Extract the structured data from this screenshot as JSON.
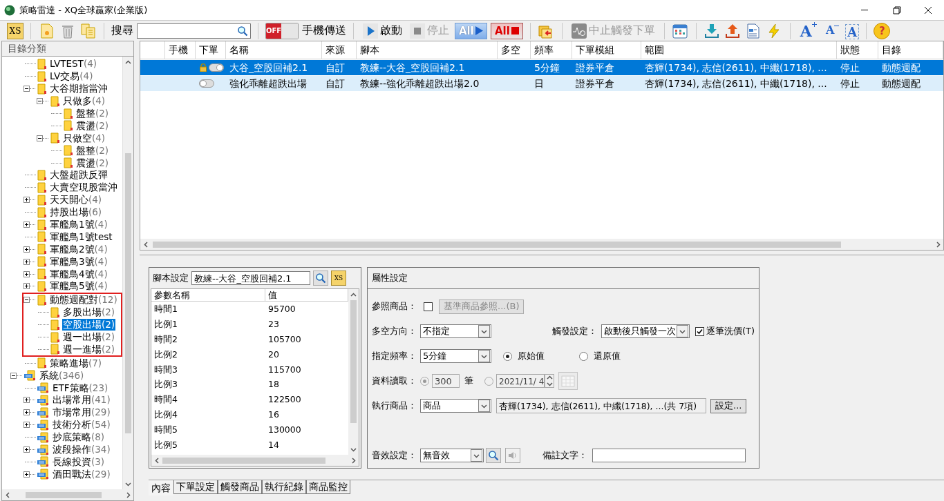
{
  "window": {
    "title": "策略雷達 - XQ全球贏家(企業版)"
  },
  "toolbar": {
    "xs_label": "XS",
    "search_label": "搜尋",
    "phone_switch": {
      "label": "OFF",
      "on": false
    },
    "phone_label": "手機傳送",
    "start": {
      "label": "啟動",
      "disabled": false
    },
    "stop": {
      "label": "停止",
      "disabled": true
    },
    "start_all": {
      "label": "All",
      "disabled": false
    },
    "stop_all": {
      "label": "All",
      "disabled": false
    },
    "abort": {
      "label": "中止觸發下單",
      "disabled": true
    },
    "font_buttons": [
      {
        "label": "A",
        "kind": "larger"
      },
      {
        "label": "A",
        "kind": "smaller"
      },
      {
        "label": "A",
        "kind": "reset"
      }
    ],
    "help_label": "?"
  },
  "tree": {
    "title": "目錄分類",
    "items": [
      {
        "label": "LVTEST",
        "count": "(4)",
        "selected": false
      },
      {
        "label": "LV交易",
        "count": "(4)",
        "selected": false
      },
      {
        "label": "大谷期指當沖",
        "expanded": true,
        "selected": false,
        "children": [
          {
            "label": "只做多",
            "count": "(4)",
            "expanded": true,
            "selected": false,
            "children": [
              {
                "label": "盤整",
                "count": "(2)",
                "selected": false
              },
              {
                "label": "震盪",
                "count": "(2)",
                "selected": false
              }
            ]
          },
          {
            "label": "只做空",
            "count": "(4)",
            "expanded": true,
            "selected": false,
            "children": [
              {
                "label": "盤整",
                "count": "(2)",
                "selected": false
              },
              {
                "label": "震盪",
                "count": "(2)",
                "selected": false
              }
            ]
          }
        ]
      },
      {
        "label": "大盤超跌反彈",
        "selected": false
      },
      {
        "label": "大賣空現股當沖",
        "selected": false
      },
      {
        "label": "天天開心",
        "count": "(4)",
        "expanded": false,
        "selected": false
      },
      {
        "label": "持股出場",
        "count": "(6)",
        "selected": false
      },
      {
        "label": "軍艦鳥1號",
        "count": "(4)",
        "expanded": false,
        "selected": false
      },
      {
        "label": "軍艦鳥1號test",
        "selected": false
      },
      {
        "label": "軍艦鳥2號",
        "count": "(4)",
        "expanded": false,
        "selected": false
      },
      {
        "label": "軍艦鳥3號",
        "count": "(4)",
        "expanded": false,
        "selected": false
      },
      {
        "label": "軍艦鳥4號",
        "count": "(4)",
        "expanded": false,
        "selected": false
      },
      {
        "label": "軍艦鳥5號",
        "count": "(4)",
        "expanded": false,
        "selected": false
      },
      {
        "label": "動態週配對",
        "count": "(12)",
        "expanded": true,
        "highlighted": true,
        "selected": false,
        "children": [
          {
            "label": "多股出場",
            "count": "(2)",
            "selected": false
          },
          {
            "label": "空股出場",
            "count": "(2)",
            "selected": true
          },
          {
            "label": "週一出場",
            "count": "(2)",
            "selected": false
          },
          {
            "label": "週一進場",
            "count": "(2)",
            "selected": false
          }
        ]
      },
      {
        "label": "策略進場",
        "count": "(7)",
        "selected": false
      }
    ],
    "system": {
      "label": "系統",
      "count": "(346)",
      "expanded": true,
      "selected": false,
      "children": [
        {
          "label": "ETF策略",
          "count": "(23)",
          "selected": false
        },
        {
          "label": "出場常用",
          "count": "(41)",
          "expanded": false,
          "selected": false
        },
        {
          "label": "市場常用",
          "count": "(29)",
          "expanded": false,
          "selected": false
        },
        {
          "label": "技術分析",
          "count": "(54)",
          "expanded": false,
          "selected": false
        },
        {
          "label": "抄底策略",
          "count": "(8)",
          "selected": false
        },
        {
          "label": "波段操作",
          "count": "(34)",
          "expanded": false,
          "selected": false
        },
        {
          "label": "長線投資",
          "count": "(3)",
          "selected": false
        },
        {
          "label": "酒田戰法",
          "count": "(29)",
          "expanded": false,
          "selected": false
        }
      ]
    }
  },
  "strategies": {
    "columns": [
      "手機",
      "下單",
      "名稱",
      "來源",
      "腳本",
      "多空",
      "頻率",
      "下單模組",
      "範圍",
      "狀態",
      "目錄"
    ],
    "rows": [
      {
        "selected": true,
        "locked": true,
        "name": "大谷_空股回補2.1",
        "source": "自訂",
        "script": "教練--大谷_空股回補2.1",
        "frequency": "5分鐘",
        "order_module": "證券平倉",
        "range": "杏輝(1734), 志信(2611), 中纖(1718), ...",
        "status": "停止",
        "directory": "動態週配"
      },
      {
        "selected": false,
        "locked": false,
        "name": "強化乖離超跌出場",
        "source": "自訂",
        "script": "教練--強化乖離超跌出場2.0",
        "frequency": "日",
        "order_module": "證券平倉",
        "range": "杏輝(1734), 志信(2611), 中纖(1718), ...",
        "status": "停止",
        "directory": "動態週配"
      }
    ]
  },
  "script_settings": {
    "label": "腳本設定",
    "script": "教練--大谷_空股回補2.1",
    "xs_label": "XS",
    "columns": [
      "參數名稱",
      "值"
    ],
    "params": [
      {
        "name": "時間1",
        "value": "95700"
      },
      {
        "name": "比例1",
        "value": "23"
      },
      {
        "name": "時間2",
        "value": "105700"
      },
      {
        "name": "比例2",
        "value": "20"
      },
      {
        "name": "時間3",
        "value": "115700"
      },
      {
        "name": "比例3",
        "value": "18"
      },
      {
        "name": "時間4",
        "value": "122500"
      },
      {
        "name": "比例4",
        "value": "16"
      },
      {
        "name": "時間5",
        "value": "130000"
      },
      {
        "name": "比例5",
        "value": "14"
      }
    ]
  },
  "properties": {
    "title": "屬性設定",
    "reference": {
      "label": "參照商品：",
      "checked": false,
      "button": "基準商品參照...(B)",
      "button_disabled": true
    },
    "direction": {
      "label": "多空方向：",
      "value": "不指定"
    },
    "trigger": {
      "label": "觸發設定：",
      "value": "啟動後只觸發一次"
    },
    "tick_wash": {
      "label": "逐筆洗價(T)",
      "checked": true
    },
    "frequency": {
      "label": "指定頻率：",
      "value": "5分鐘"
    },
    "price_modes": [
      {
        "label": "原始值",
        "selected": true
      },
      {
        "label": "還原值",
        "selected": false
      }
    ],
    "data_read": {
      "label": "資料讀取：",
      "disabled": true,
      "options": [
        {
          "kind": "bars",
          "selected": true,
          "value": "300",
          "unit": "筆"
        },
        {
          "kind": "date",
          "selected": false,
          "value": "2021/11/ 4"
        }
      ]
    },
    "targets": {
      "label": "執行商品：",
      "value": "商品",
      "list": "杏輝(1734), 志信(2611), 中纖(1718), ...(共 7項)",
      "button": "設定..."
    },
    "sound": {
      "label": "音效設定：",
      "value": "無音效"
    },
    "note": {
      "label": "備註文字："
    }
  },
  "tabs": [
    {
      "label": "內容",
      "selected": true
    },
    {
      "label": "下單設定",
      "selected": false
    },
    {
      "label": "觸發商品",
      "selected": false
    },
    {
      "label": "執行紀錄",
      "selected": false
    },
    {
      "label": "商品監控",
      "selected": false
    }
  ]
}
